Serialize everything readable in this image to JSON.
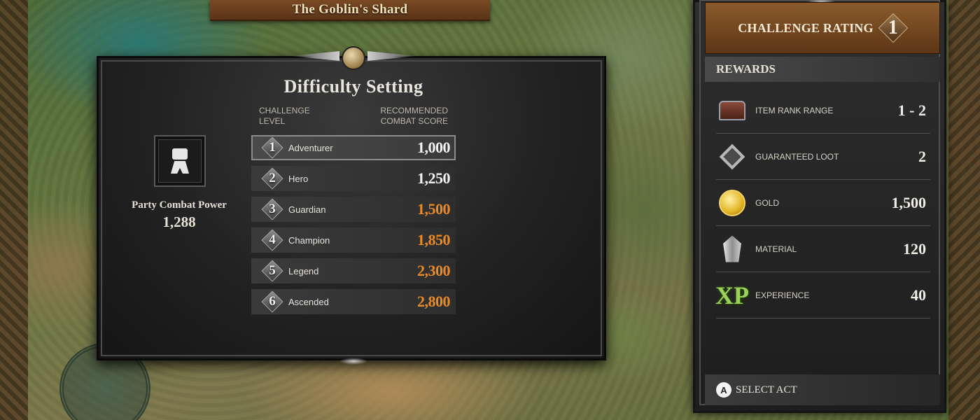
{
  "map": {
    "title": "The Goblin's Shard"
  },
  "difficulty_dialog": {
    "title": "Difficulty Setting",
    "column_challenge": "Challenge Level",
    "column_score": "Recommended Combat Score",
    "party": {
      "label": "Party Combat Power",
      "value": "1,288",
      "icon": "fist-icon"
    },
    "levels": [
      {
        "number": "1",
        "name": "Adventurer",
        "score": "1,000",
        "status": "ok",
        "selected": true
      },
      {
        "number": "2",
        "name": "Hero",
        "score": "1,250",
        "status": "ok",
        "selected": false
      },
      {
        "number": "3",
        "name": "Guardian",
        "score": "1,500",
        "status": "warn",
        "selected": false
      },
      {
        "number": "4",
        "name": "Champion",
        "score": "1,850",
        "status": "warn",
        "selected": false
      },
      {
        "number": "5",
        "name": "Legend",
        "score": "2,300",
        "status": "warn",
        "selected": false
      },
      {
        "number": "6",
        "name": "Ascended",
        "score": "2,800",
        "status": "warn",
        "selected": false
      }
    ],
    "colors": {
      "ok": "#f2f2f2",
      "warn": "#e98a26"
    }
  },
  "rewards_panel": {
    "challenge_rating_label": "Challenge Rating",
    "challenge_rating_value": "1",
    "rewards_header": "Rewards",
    "items": [
      {
        "icon": "chest-icon",
        "label": "Item Rank Range",
        "value": "1 - 2"
      },
      {
        "icon": "diamond-icon",
        "label": "Guaranteed Loot",
        "value": "2"
      },
      {
        "icon": "gold-coin-icon",
        "label": "Gold",
        "value": "1,500"
      },
      {
        "icon": "crystal-icon",
        "label": "Material",
        "value": "120"
      },
      {
        "icon": "xp-icon",
        "label": "Experience",
        "value": "40",
        "icon_text": "XP"
      }
    ],
    "footer": {
      "button_glyph": "A",
      "label": "Select Act"
    }
  }
}
